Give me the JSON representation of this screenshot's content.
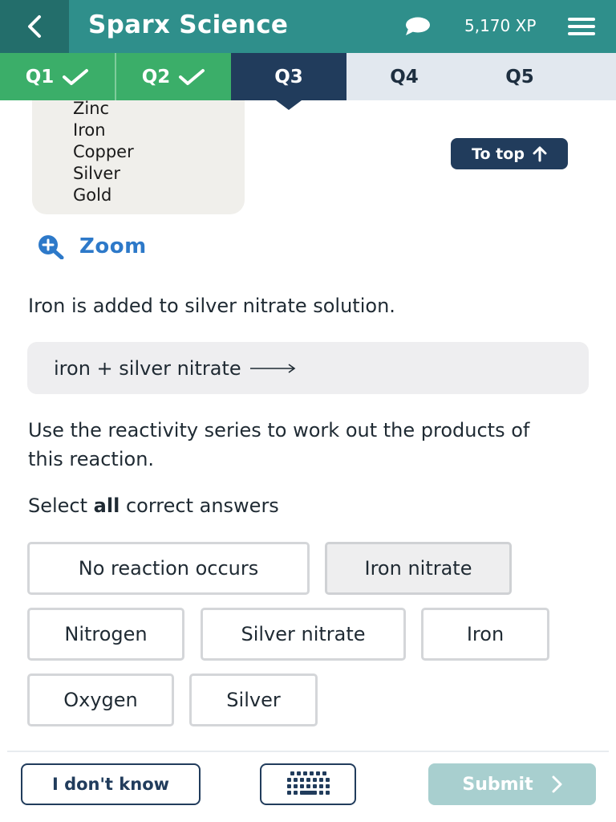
{
  "header": {
    "title": "Sparx Science",
    "xp": "5,170 XP",
    "icons": {
      "back": "chevron-left-icon",
      "chat": "speech-bubble-icon",
      "menu": "hamburger-menu-icon"
    }
  },
  "tabs": [
    {
      "label": "Q1",
      "state": "done"
    },
    {
      "label": "Q2",
      "state": "done"
    },
    {
      "label": "Q3",
      "state": "active"
    },
    {
      "label": "Q4",
      "state": "todo"
    },
    {
      "label": "Q5",
      "state": "todo"
    }
  ],
  "reactivity_series": [
    "Zinc",
    "Iron",
    "Copper",
    "Silver",
    "Gold"
  ],
  "to_top": "To top",
  "zoom": "Zoom",
  "question": {
    "intro": "Iron is added to silver nitrate solution.",
    "equation": "iron + silver nitrate",
    "instruction": "Use the reactivity series to work out the products of this reaction.",
    "select_prefix": "Select ",
    "select_bold": "all",
    "select_suffix": " correct answers"
  },
  "options": [
    {
      "label": "No reaction occurs",
      "selected": false
    },
    {
      "label": "Iron nitrate",
      "selected": true
    },
    {
      "label": "Nitrogen",
      "selected": false
    },
    {
      "label": "Silver nitrate",
      "selected": false
    },
    {
      "label": "Iron",
      "selected": false
    },
    {
      "label": "Oxygen",
      "selected": false
    },
    {
      "label": "Silver",
      "selected": false
    }
  ],
  "footer": {
    "dont_know": "I don't know",
    "submit": "Submit"
  },
  "colors": {
    "header": "#2f8f8b",
    "tab_done": "#3bae69",
    "tab_active": "#213c5c",
    "accent_blue": "#2d79c9",
    "submit_disabled": "#a8cfcf"
  }
}
